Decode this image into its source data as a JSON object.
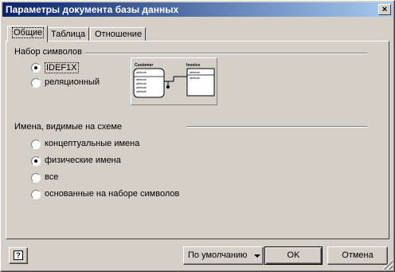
{
  "dialog": {
    "title": "Параметры документа базы данных",
    "close_glyph": "×"
  },
  "tabs": [
    {
      "label": "Общие",
      "active": true
    },
    {
      "label": "Таблица",
      "active": false
    },
    {
      "label": "Отношение",
      "active": false
    }
  ],
  "notation": {
    "label": "Набор символов",
    "options": [
      {
        "label": "IDEF1X",
        "selected": true
      },
      {
        "label": "реляционный",
        "selected": false
      }
    ]
  },
  "preview": {
    "left_entity": "Customer",
    "right_entity": "Invoice",
    "attr_text": "attribute"
  },
  "names": {
    "label": "Имена, видимые на схеме",
    "options": [
      {
        "label": "концептуальные имена",
        "selected": false
      },
      {
        "label": "физические имена",
        "selected": true
      },
      {
        "label": "все",
        "selected": false
      },
      {
        "label": "основанные на наборе символов",
        "selected": false
      }
    ]
  },
  "footer": {
    "help_glyph": "?",
    "defaults_label": "По умолчанию",
    "ok_label": "OK",
    "cancel_label": "Отмена"
  },
  "colors": {
    "title_start": "#0a246a",
    "title_end": "#a6caf0",
    "face": "#d4d0c8"
  }
}
